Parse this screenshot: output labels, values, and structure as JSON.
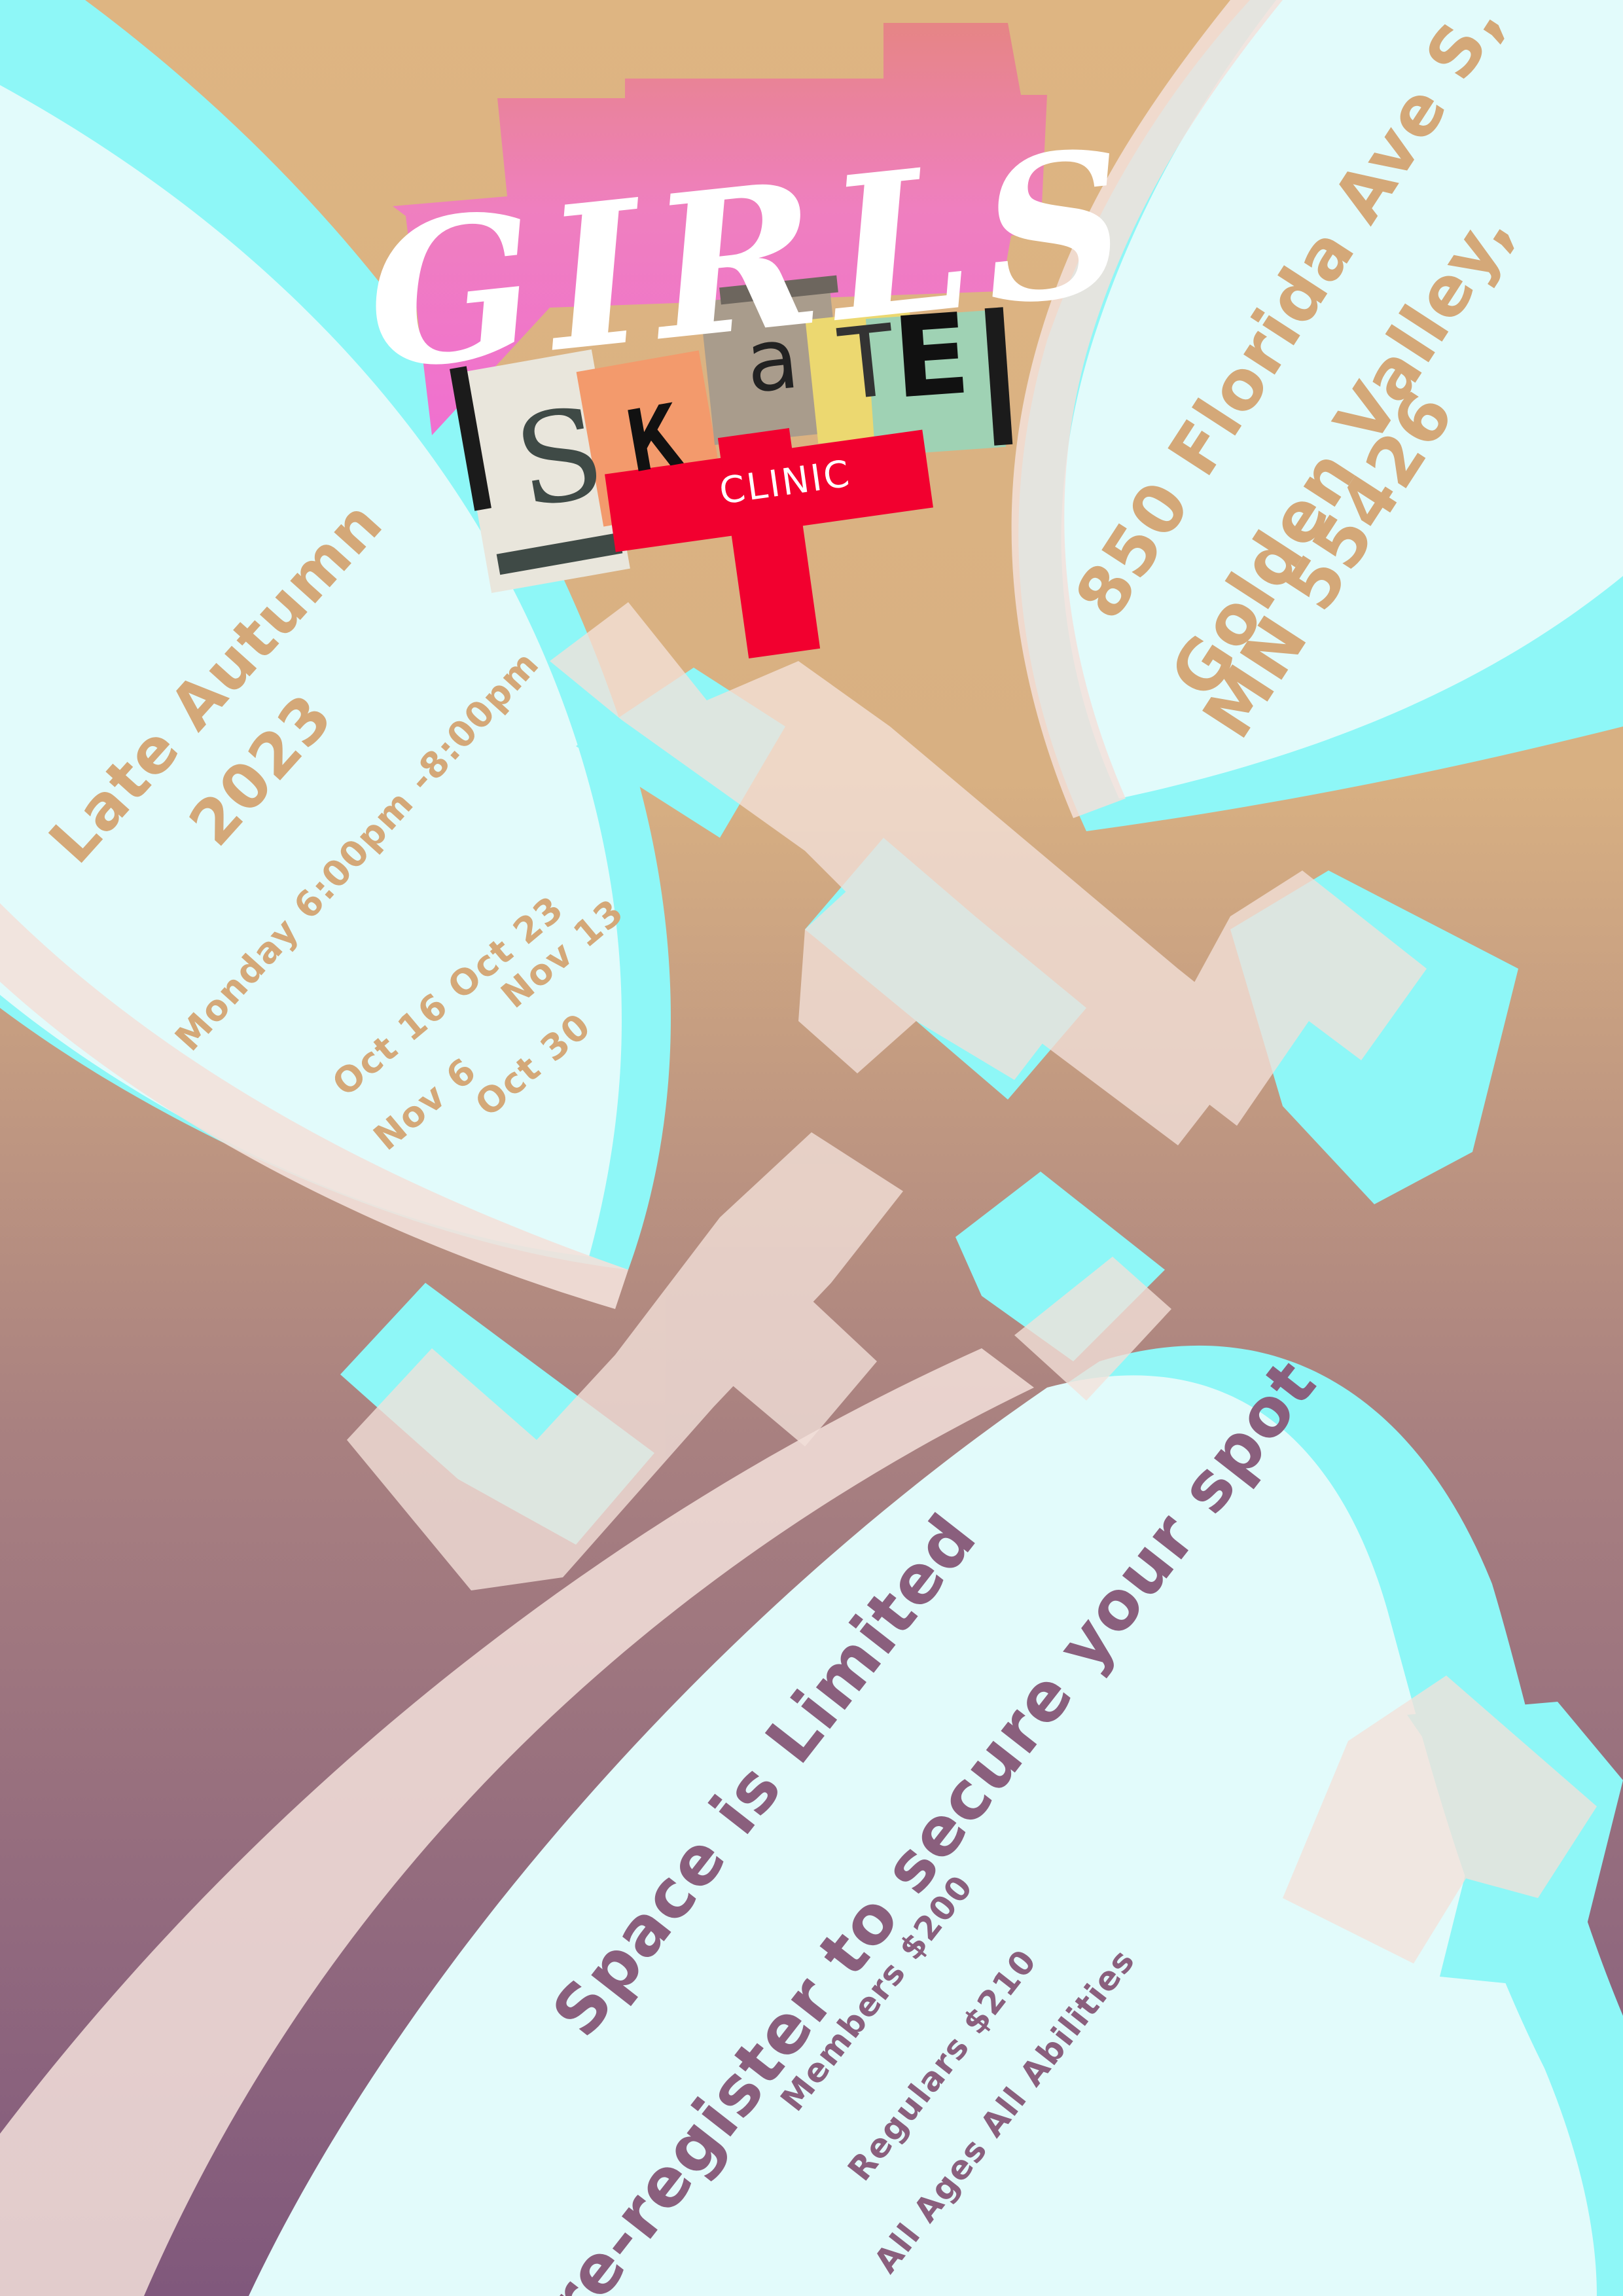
{
  "logo": {
    "title": "GIRLS",
    "skate_letters": [
      "S",
      "K",
      "a",
      "T",
      "E"
    ],
    "clinic": "CLINIC"
  },
  "season": {
    "line1": "Late Autumn",
    "line2": "2023",
    "schedule": "Monday 6:00pm -8:00pm",
    "dates_row1": "Oct 16  Oct 23",
    "dates_row1b": "Nov 13",
    "dates_row2": "Nov 6",
    "dates_row2b": "Oct 30"
  },
  "address": {
    "line1": "850 Florida Ave S,",
    "line2": "Golden Valley,",
    "line3": "MN 55426"
  },
  "info": {
    "headline": "Space is Limited",
    "cta": "Pre-register to secure your spot",
    "members": "Members $200",
    "regulars": "Regulars $210",
    "ages": "All Ages All Abilities"
  },
  "colors": {
    "tan": "#d4a878",
    "plum": "#8a5f7d",
    "cyan": "#8ef7f7",
    "pale": "#e2fbfb",
    "cream": "#f3e1da",
    "red_cross": "#f2002f"
  }
}
